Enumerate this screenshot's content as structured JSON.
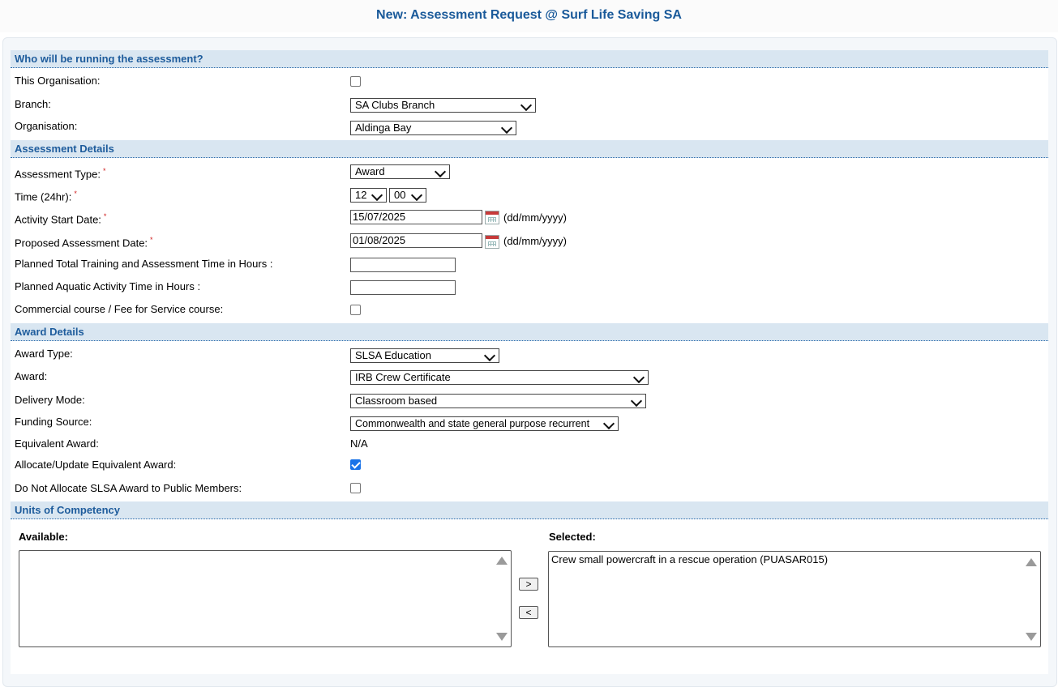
{
  "title": "New: Assessment Request @ Surf Life Saving SA",
  "sections": {
    "running": "Who will be running the assessment?",
    "assessment": "Assessment Details",
    "award": "Award Details",
    "units": "Units of Competency"
  },
  "running": {
    "this_org_label": "This Organisation:",
    "this_org_checked": false,
    "branch_label": "Branch:",
    "branch_value": "SA Clubs Branch",
    "organisation_label": "Organisation:",
    "organisation_value": "Aldinga Bay"
  },
  "assessment": {
    "type_label": "Assessment Type:",
    "type_value": "Award",
    "time_label": "Time (24hr):",
    "time_hour": "12",
    "time_minute": "00",
    "start_label": "Activity Start Date:",
    "start_value": "15/07/2025",
    "date_format": "(dd/mm/yyyy)",
    "proposed_label": "Proposed Assessment Date:",
    "proposed_value": "01/08/2025",
    "training_hours_label": "Planned Total Training and Assessment Time in Hours :",
    "training_hours_value": "",
    "aquatic_hours_label": "Planned Aquatic Activity Time in Hours :",
    "aquatic_hours_value": "",
    "commercial_label": "Commercial course / Fee for Service course:",
    "commercial_checked": false
  },
  "award": {
    "type_label": "Award Type:",
    "type_value": "SLSA Education",
    "award_label": "Award:",
    "award_value": "IRB Crew Certificate",
    "delivery_label": "Delivery Mode:",
    "delivery_value": "Classroom based",
    "funding_label": "Funding Source:",
    "funding_value": "Commonwealth and state general purpose recurrent",
    "equivalent_label": "Equivalent Award:",
    "equivalent_value": "N/A",
    "allocate_label": "Allocate/Update Equivalent Award:",
    "allocate_checked": true,
    "no_allocate_label": "Do Not Allocate SLSA Award to Public Members:",
    "no_allocate_checked": false
  },
  "units": {
    "available_label": "Available:",
    "selected_label": "Selected:",
    "available_items": [],
    "selected_items": [
      "Crew small powercraft in a rescue operation (PUASAR015)"
    ],
    "add_button": ">",
    "remove_button": "<"
  },
  "colors": {
    "title": "#1a5a9a",
    "section_bg": "#d9e6f1",
    "section_text": "#1e5c9c",
    "required": "#d02020",
    "checkbox_checked": "#1a73e8"
  },
  "icons": [
    "calendar-icon",
    "chevron-down-icon",
    "scroll-up-icon",
    "scroll-down-icon"
  ]
}
